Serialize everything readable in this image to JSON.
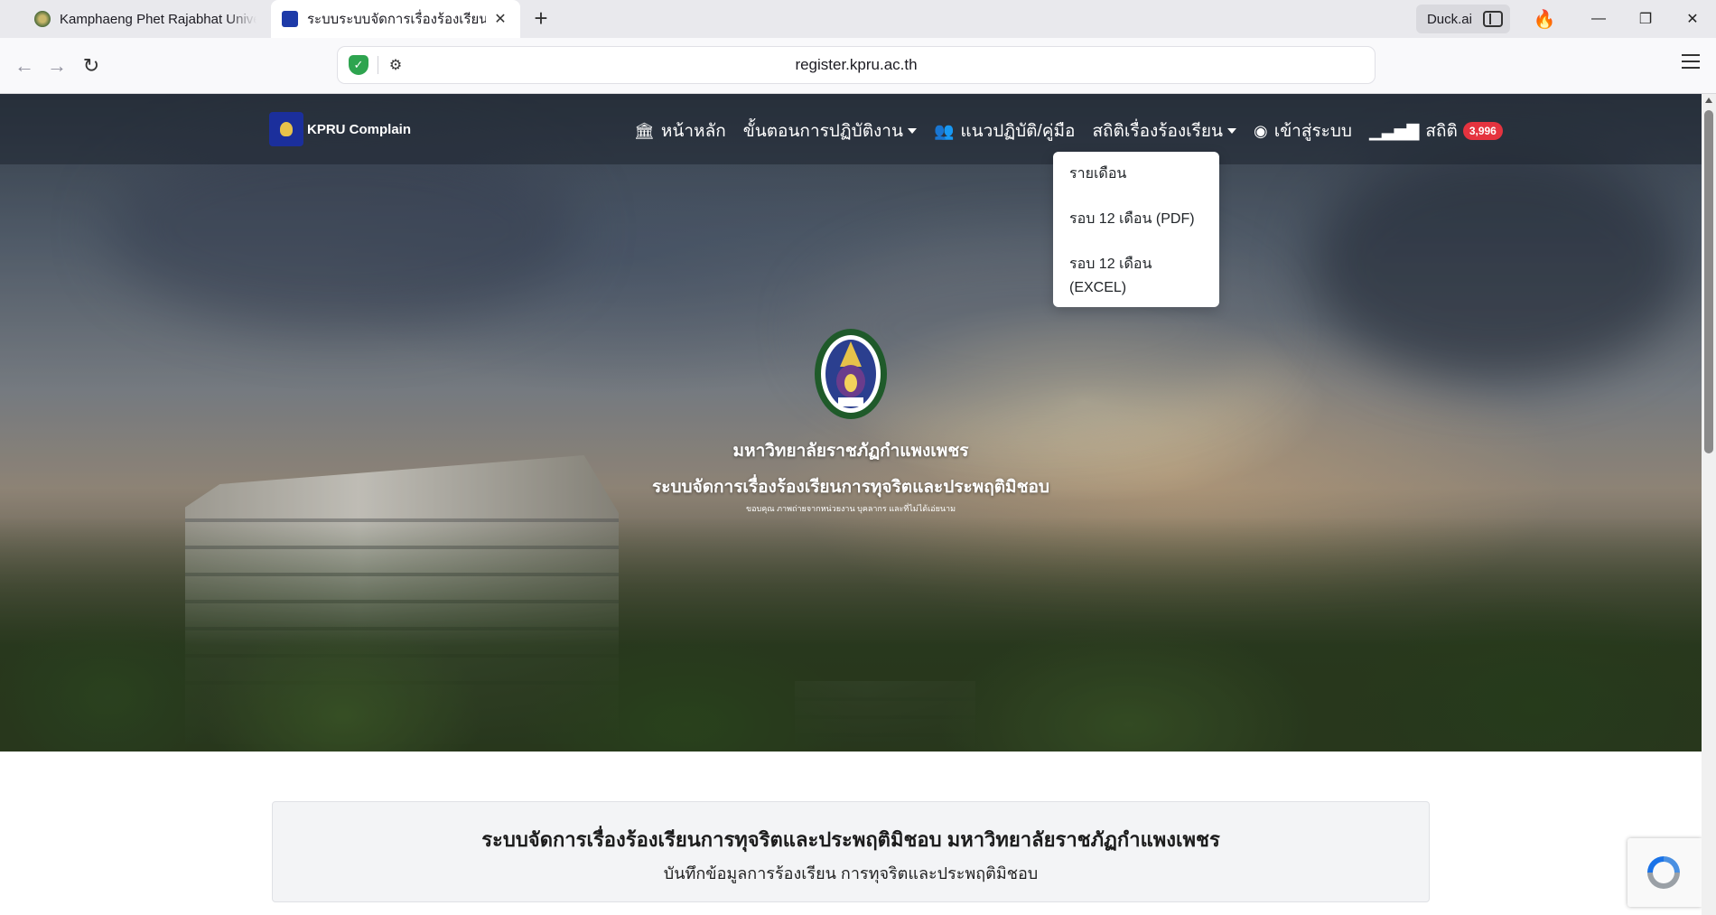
{
  "browser": {
    "tabs": [
      {
        "title": "Kamphaeng Phet Rajabhat Univers",
        "active": false
      },
      {
        "title": "ระบบระบบจัดการเรื่องร้องเรียนการทุ",
        "active": true
      }
    ],
    "duck_label": "Duck.ai",
    "url": "register.kpru.ac.th"
  },
  "site": {
    "brand": "KPRU Complain",
    "menu": {
      "home": "หน้าหลัก",
      "procedure": "ขั้นตอนการปฏิบัติงาน",
      "guide": "แนวปฏิบัติ/คู่มือ",
      "stats_complaints": "สถิติเรื่องร้องเรียน",
      "login": "เข้าสู่ระบบ",
      "stats": "สถิติ",
      "stats_count": "3,996"
    },
    "dropdown": [
      "รายเดือน",
      "รอบ 12 เดือน (PDF)",
      "รอบ 12 เดือน (EXCEL)"
    ]
  },
  "hero": {
    "university": "มหาวิทยาลัยราชภัฏกำแพงเพชร",
    "system": "ระบบจัดการเรื่องร้องเรียนการทุจริตและประพฤติมิชอบ",
    "credit": "ขอบคุณ ภาพถ่ายจากหน่วยงาน บุคลากร และที่ไม่ได้เอ่ยนาม"
  },
  "info": {
    "title": "ระบบจัดการเรื่องร้องเรียนการทุจริตและประพฤติมิชอบ มหาวิทยาลัยราชภัฏกำแพงเพชร",
    "subtitle": "บันทึกข้อมูลการร้องเรียน การทุจริตและประพฤติมิชอบ"
  },
  "colors": {
    "badge": "#e5333f",
    "brand_blue": "#1b2f9c"
  }
}
